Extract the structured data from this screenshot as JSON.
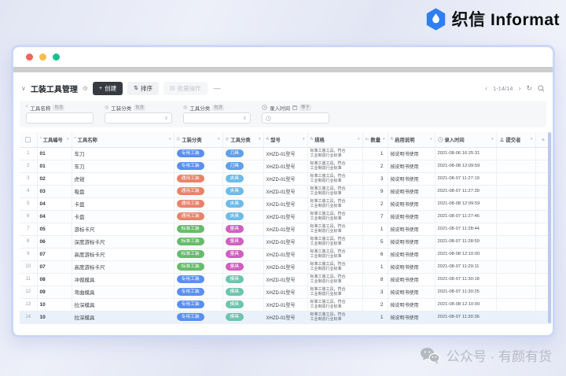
{
  "brand": {
    "logo_text": "织信 Informat",
    "accent": "#2e7ff0"
  },
  "icons": {
    "collapse": "∨",
    "gear": "⚙",
    "plus": "+",
    "sort": "⇅",
    "batch": "▤",
    "more": "—",
    "prev": "‹",
    "next": "›",
    "refresh": "↻",
    "caret_down": "∨",
    "header_caret": "▾",
    "asterisk": "*",
    "select": "◎",
    "letter": "A",
    "number": "x₂",
    "add_column": "+"
  },
  "panel": {
    "toolbar": {
      "title": "工装工具管理",
      "create_label": "创建",
      "sort_label": "排序",
      "batch_label": "批量操作",
      "pagination": "1-14/14"
    },
    "filters": {
      "name": {
        "label": "工具名称",
        "op": "包含",
        "value": ""
      },
      "tooling_type": {
        "label": "工装分类",
        "op": "包含",
        "value": ""
      },
      "tool_type": {
        "label": "工具分类",
        "op": "包含",
        "value": ""
      },
      "entry_time": {
        "label": "录入时间",
        "op": "等于",
        "value": ""
      }
    }
  },
  "table": {
    "headers": [
      {
        "id": "rownum",
        "label": "",
        "icon": "checkbox"
      },
      {
        "id": "code",
        "label": "工具编号",
        "icon": "asterisk"
      },
      {
        "id": "name",
        "label": "工具名称",
        "icon": "asterisk"
      },
      {
        "id": "tooling_type",
        "label": "工装分类",
        "icon": "select"
      },
      {
        "id": "tool_type",
        "label": "工具分类",
        "icon": "select"
      },
      {
        "id": "model",
        "label": "型号",
        "icon": "letter"
      },
      {
        "id": "spec",
        "label": "规格",
        "icon": "letter"
      },
      {
        "id": "qty",
        "label": "数量",
        "icon": "number"
      },
      {
        "id": "usage_note",
        "label": "启用说明",
        "icon": "letter"
      },
      {
        "id": "entry_time",
        "label": "录入时间",
        "icon": "clock"
      },
      {
        "id": "submitter",
        "label": "提交者",
        "icon": "user"
      },
      {
        "id": "add",
        "label": "+",
        "icon": "plus"
      }
    ],
    "pill_colors": {
      "专用工装": "#5a8ff0",
      "通用工装": "#e8826a",
      "标准工装": "#67bb6b",
      "刀具": "#61a0e8",
      "夹具": "#6fbbe8",
      "量具": "#d05fc0",
      "模具": "#6fc4ae"
    },
    "rows": [
      {
        "num": 1,
        "code": "01",
        "name": "车刀",
        "tooling_type": "专用工装",
        "tool_type": "刀具",
        "model": "XHZD-01型号",
        "spec": [
          "标准工装工具，符合",
          "工业制造行业标准"
        ],
        "qty": 1,
        "usage_note": "按说明书使用",
        "entry_time": "2021-08-06 16:25:31",
        "submitter": ""
      },
      {
        "num": 2,
        "code": "01",
        "name": "车刀",
        "tooling_type": "专用工装",
        "tool_type": "刀具",
        "model": "XHZD-01型号",
        "spec": [
          "标准工装工具，符合",
          "工业制造行业标准"
        ],
        "qty": 2,
        "usage_note": "按说明书使用",
        "entry_time": "2021-08-08 12:09:59",
        "submitter": ""
      },
      {
        "num": 3,
        "code": "02",
        "name": "虎钳",
        "tooling_type": "通用工装",
        "tool_type": "夹具",
        "model": "XHZD-01型号",
        "spec": [
          "标准工装工具，符合",
          "工业制造行业标准"
        ],
        "qty": 3,
        "usage_note": "按说明书使用",
        "entry_time": "2021-08-07 11:27:19",
        "submitter": ""
      },
      {
        "num": 4,
        "code": "03",
        "name": "吸盘",
        "tooling_type": "通用工装",
        "tool_type": "夹具",
        "model": "XHZD-01型号",
        "spec": [
          "标准工装工具，符合",
          "工业制造行业标准"
        ],
        "qty": 9,
        "usage_note": "按说明书使用",
        "entry_time": "2021-08-07 11:27:39",
        "submitter": ""
      },
      {
        "num": 5,
        "code": "04",
        "name": "卡盘",
        "tooling_type": "通用工装",
        "tool_type": "夹具",
        "model": "XHZD-01型号",
        "spec": [
          "标准工装工具，符合",
          "工业制造行业标准"
        ],
        "qty": 2,
        "usage_note": "按说明书使用",
        "entry_time": "2021-08-08 12:09:59",
        "submitter": ""
      },
      {
        "num": 6,
        "code": "04",
        "name": "卡盘",
        "tooling_type": "通用工装",
        "tool_type": "夹具",
        "model": "XHZD-01型号",
        "spec": [
          "标准工装工具，符合",
          "工业制造行业标准"
        ],
        "qty": 7,
        "usage_note": "按说明书使用",
        "entry_time": "2021-08-07 11:27:46",
        "submitter": ""
      },
      {
        "num": 7,
        "code": "05",
        "name": "游标卡尺",
        "tooling_type": "标准工装",
        "tool_type": "量具",
        "model": "XHZD-01型号",
        "spec": [
          "标准工装工具，符合",
          "工业制造行业标准"
        ],
        "qty": 1,
        "usage_note": "按说明书使用",
        "entry_time": "2021-08-07 11:28:44",
        "submitter": ""
      },
      {
        "num": 8,
        "code": "06",
        "name": "深度游标卡尺",
        "tooling_type": "标准工装",
        "tool_type": "量具",
        "model": "XHZD-01型号",
        "spec": [
          "标准工装工具，符合",
          "工业制造行业标准"
        ],
        "qty": 5,
        "usage_note": "按说明书使用",
        "entry_time": "2021-08-07 11:28:59",
        "submitter": ""
      },
      {
        "num": 9,
        "code": "07",
        "name": "高度游标卡尺",
        "tooling_type": "标准工装",
        "tool_type": "量具",
        "model": "XHZD-01型号",
        "spec": [
          "标准工装工具，符合",
          "工业制造行业标准"
        ],
        "qty": 6,
        "usage_note": "按说明书使用",
        "entry_time": "2021-08-08 12:10:00",
        "submitter": ""
      },
      {
        "num": 10,
        "code": "07",
        "name": "高度游标卡尺",
        "tooling_type": "标准工装",
        "tool_type": "量具",
        "model": "XHZD-01型号",
        "spec": [
          "标准工装工具，符合",
          "工业制造行业标准"
        ],
        "qty": 1,
        "usage_note": "按说明书使用",
        "entry_time": "2021-08-07 11:29:11",
        "submitter": ""
      },
      {
        "num": 11,
        "code": "08",
        "name": "冲裁模具",
        "tooling_type": "专用工装",
        "tool_type": "模具",
        "model": "XHZD-01型号",
        "spec": [
          "标准工装工具，符合",
          "工业制造行业标准"
        ],
        "qty": 8,
        "usage_note": "按说明书使用",
        "entry_time": "2021-08-07 11:30:18",
        "submitter": ""
      },
      {
        "num": 12,
        "code": "09",
        "name": "弯曲模具",
        "tooling_type": "专用工装",
        "tool_type": "模具",
        "model": "XHZD-01型号",
        "spec": [
          "标准工装工具，符合",
          "工业制造行业标准"
        ],
        "qty": 3,
        "usage_note": "按说明书使用",
        "entry_time": "2021-08-07 11:30:25",
        "submitter": ""
      },
      {
        "num": 13,
        "code": "10",
        "name": "拉深模具",
        "tooling_type": "专用工装",
        "tool_type": "模具",
        "model": "XHZD-01型号",
        "spec": [
          "标准工装工具，符合",
          "工业制造行业标准"
        ],
        "qty": 2,
        "usage_note": "按说明书使用",
        "entry_time": "2021-08-08 12:10:00",
        "submitter": ""
      },
      {
        "num": 14,
        "code": "10",
        "name": "拉深模具",
        "tooling_type": "专用工装",
        "tool_type": "模具",
        "model": "XHZD-01型号",
        "spec": [
          "标准工装工具，符合",
          "工业制造行业标准"
        ],
        "qty": 1,
        "usage_note": "按说明书使用",
        "entry_time": "2021-08-07 11:30:36",
        "submitter": ""
      }
    ]
  },
  "watermark": {
    "text": "公众号 · 有颜有货"
  }
}
